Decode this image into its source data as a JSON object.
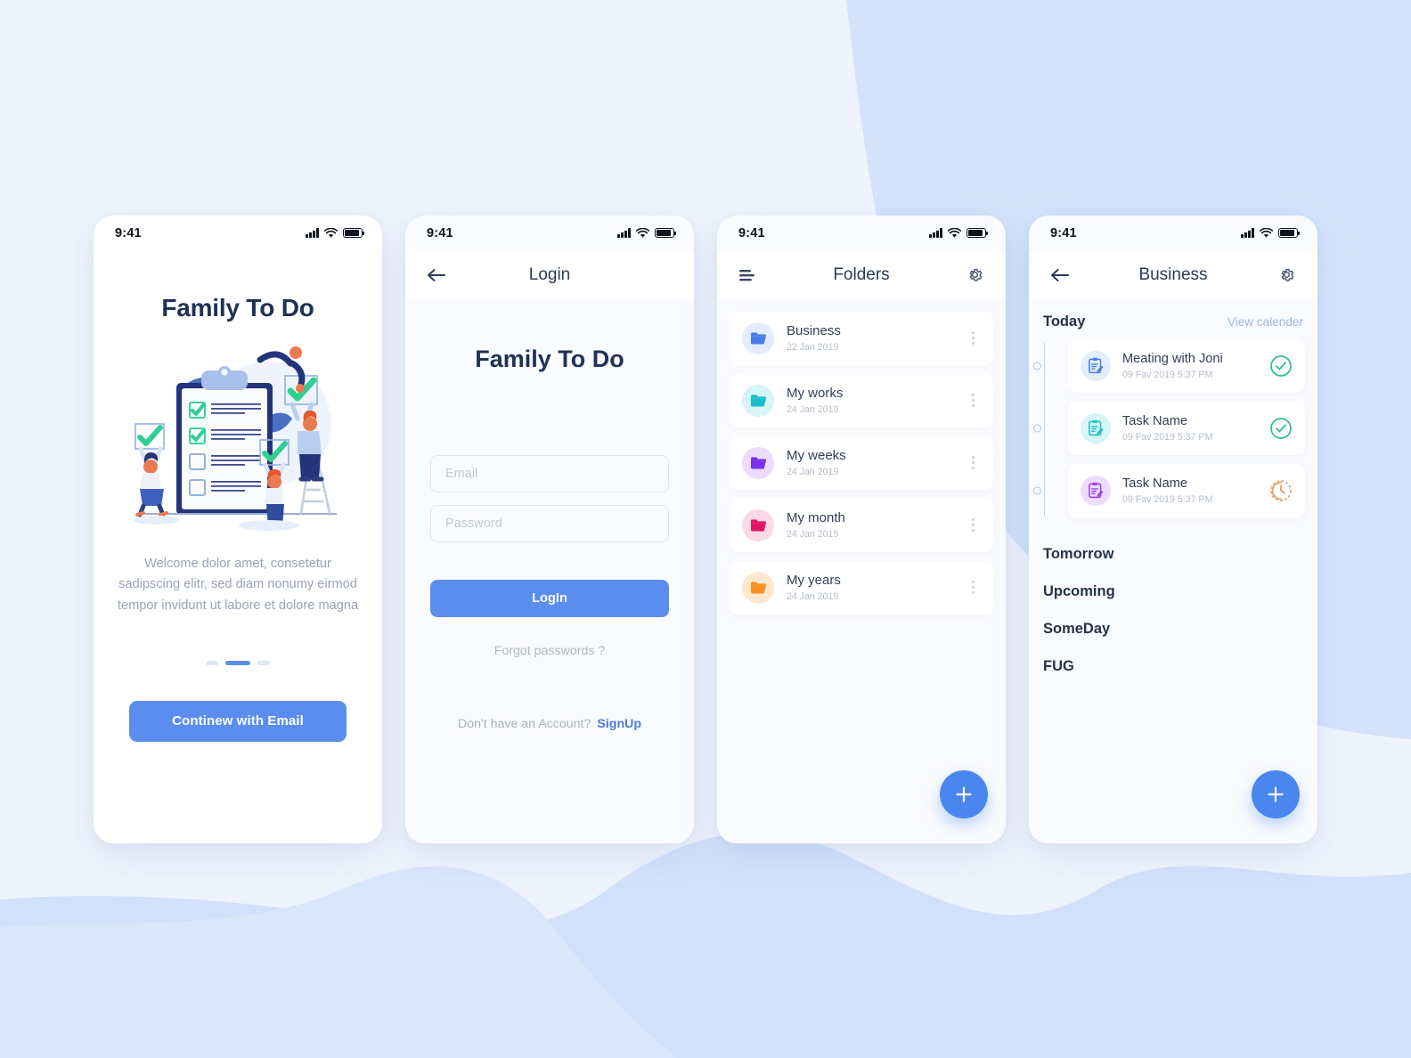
{
  "colors": {
    "accent": "#5b8def",
    "fab": "#4a86ef",
    "heading": "#1f3157",
    "muted": "#9aa3b5",
    "page_bg": "#eef3fd",
    "wave": "#cfdffa",
    "screen_bg": "#fafbfe",
    "done_green": "#2bbf8e",
    "pending_orange": "#e89e5e"
  },
  "status_bar": {
    "time": "9:41",
    "signal_icon": "signal-bars-icon",
    "wifi_icon": "wifi-icon",
    "battery_icon": "battery-icon"
  },
  "screen_onboarding": {
    "title": "Family To Do",
    "illustration": "checklist-teamwork-illustration",
    "description": "Welcome dolor amet, consetetur sadipscing elitr, sed diam nonumy eirmod tempor invidunt ut labore et dolore magna",
    "pager": {
      "count": 3,
      "active_index": 1
    },
    "cta_label": "Continew with Email"
  },
  "screen_login": {
    "nav": {
      "title": "Login",
      "back_icon": "arrow-left-icon"
    },
    "brand": "Family To Do",
    "email": {
      "value": "",
      "placeholder": "Email"
    },
    "password": {
      "value": "",
      "placeholder": "Password"
    },
    "login_label": "LogIn",
    "forgot_label": "Forgot passwords ?",
    "signup_prompt": "Don't have an Account?",
    "signup_label": "SignUp"
  },
  "screen_folders": {
    "nav": {
      "title": "Folders",
      "menu_icon": "hamburger-menu-icon",
      "settings_icon": "gear-icon"
    },
    "items": [
      {
        "name": "Business",
        "date": "22 Jan 2019",
        "icon": "folder-icon",
        "color": "#4a7ee8",
        "bg": "#e4edfc"
      },
      {
        "name": "My works",
        "date": "24 Jan 2019",
        "icon": "folder-icon",
        "color": "#18bfcb",
        "bg": "#d6f5f4"
      },
      {
        "name": "My weeks",
        "date": "24 Jan 2019",
        "icon": "folder-icon",
        "color": "#7b2ff0",
        "bg": "#ecdcfb"
      },
      {
        "name": "My month",
        "date": "24 Jan 2019",
        "icon": "folder-icon",
        "color": "#e01563",
        "bg": "#fbd9e6"
      },
      {
        "name": "My years",
        "date": "24 Jan 2019",
        "icon": "folder-icon",
        "color": "#f7921e",
        "bg": "#fde7cf"
      }
    ],
    "row_menu_icon": "kebab-menu-icon",
    "add_label": "plus-icon"
  },
  "screen_tasks": {
    "nav": {
      "title": "Business",
      "back_icon": "arrow-left-icon",
      "settings_icon": "gear-icon"
    },
    "today_label": "Today",
    "view_calendar_label": "View calender",
    "tasks": [
      {
        "name": "Meating with Joni",
        "date": "09 Fav 2019  5:37 PM",
        "icon": "clipboard-edit-icon",
        "color": "#4a7ee8",
        "bg": "#e4edfc",
        "status": "done",
        "status_icon": "check-circle-icon"
      },
      {
        "name": "Task Name",
        "date": "09 Fav 2019  5:37 PM",
        "icon": "clipboard-edit-icon",
        "color": "#18bfcb",
        "bg": "#d6f5f4",
        "status": "done",
        "status_icon": "check-circle-icon"
      },
      {
        "name": "Task Name",
        "date": "09 Fav 2019  5:37 PM",
        "icon": "clipboard-edit-icon",
        "color": "#9b41e8",
        "bg": "#eddcfb",
        "status": "pending",
        "status_icon": "clock-dashed-icon"
      }
    ],
    "sections": [
      "Tomorrow",
      "Upcoming",
      "SomeDay",
      "FUG"
    ],
    "add_label": "plus-icon"
  }
}
